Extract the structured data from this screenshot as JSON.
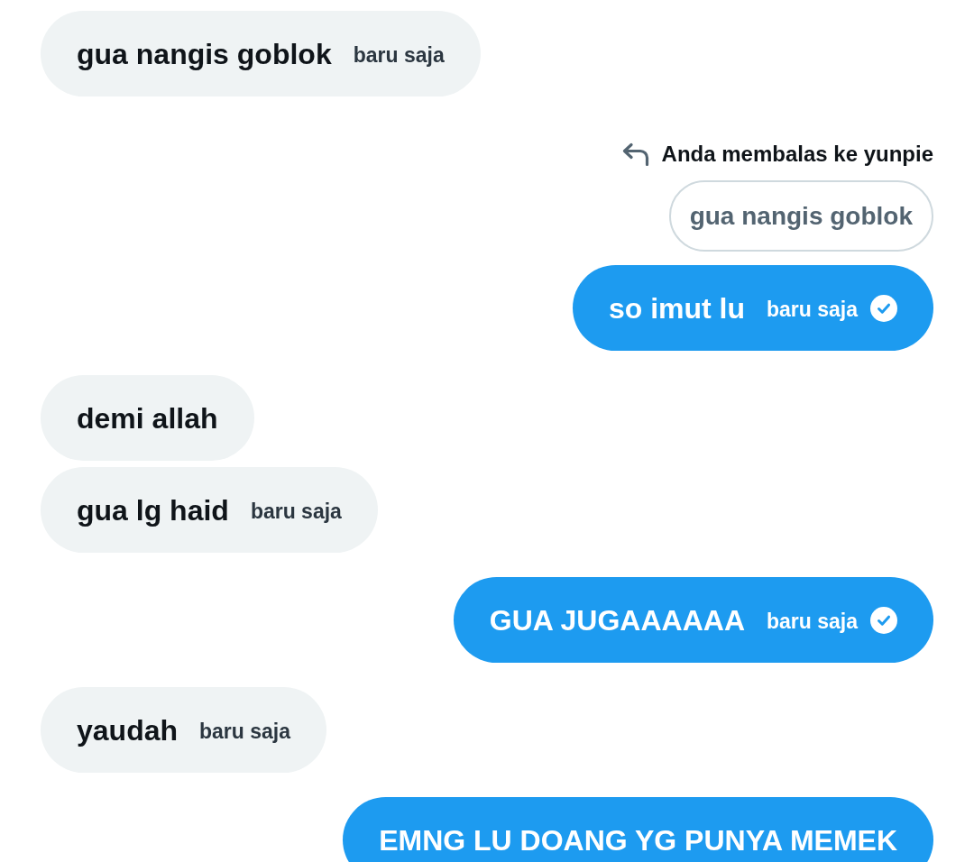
{
  "messages": [
    {
      "kind": "received",
      "text": "gua nangis goblok",
      "time": "baru saja",
      "delivered": false
    },
    {
      "kind": "sent",
      "reply_to": {
        "label": "Anda membalas ke yunpie",
        "quoted_text": "gua nangis goblok"
      },
      "text": "so imut lu",
      "time": "baru saja",
      "delivered": true
    },
    {
      "kind": "received",
      "text": "demi allah",
      "delivered": false
    },
    {
      "kind": "received",
      "text": "gua lg haid",
      "time": "baru saja",
      "delivered": false
    },
    {
      "kind": "sent",
      "text": "GUA JUGAAAAAA",
      "time": "baru saja",
      "delivered": true
    },
    {
      "kind": "received",
      "text": "yaudah",
      "time": "baru saja",
      "delivered": false
    },
    {
      "kind": "sent",
      "text": "EMNG LU DOANG YG PUNYA MEMEK",
      "delivered": false
    }
  ]
}
